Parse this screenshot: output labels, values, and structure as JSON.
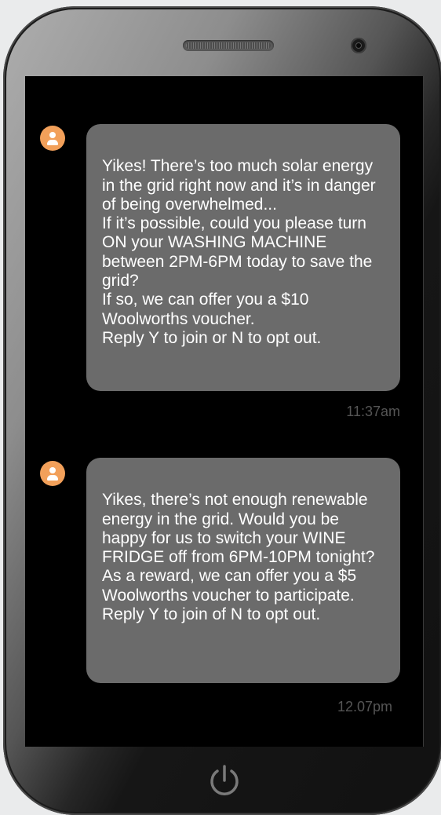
{
  "messages": [
    {
      "text": "Yikes! There’s too much solar energy in the grid right now and it’s in danger of being overwhelmed...\nIf it’s possible, could you please turn ON your WASHING MACHINE between 2PM-6PM today to save the grid?\nIf so, we can offer you a $10 Woolworths voucher.\nReply Y to join or N to opt out.",
      "time": "11:37am"
    },
    {
      "text": "Yikes, there’s not enough renewable energy in the grid. Would you be happy for us to switch your WINE FRIDGE off from 6PM-10PM tonight?\nAs a reward, we can offer you a $5 Woolworths voucher to participate.\nReply Y to join of N to opt out.",
      "time": "12.07pm"
    }
  ],
  "colors": {
    "avatar": "#f2a05a",
    "bubble": "#6b6b6b",
    "timestamp": "#555555",
    "screen": "#000000"
  },
  "icons": {
    "avatar": "person-icon",
    "home_button": "power-icon"
  }
}
